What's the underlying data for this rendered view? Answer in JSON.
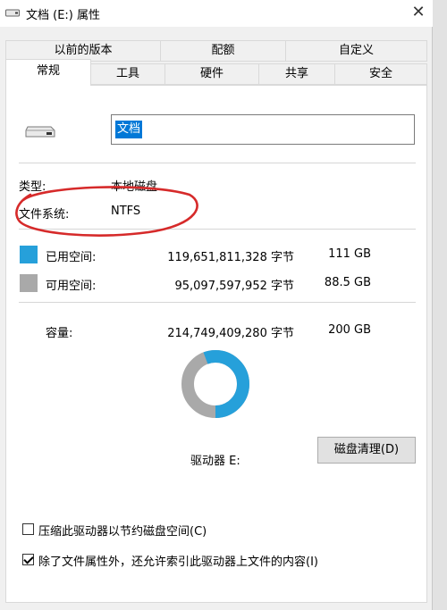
{
  "window": {
    "title": "文档 (E:) 属性",
    "close_glyph": "✕"
  },
  "tabs_row1": [
    "以前的版本",
    "配额",
    "自定义"
  ],
  "tabs_row2": [
    "常规",
    "工具",
    "硬件",
    "共享",
    "安全"
  ],
  "general": {
    "drive_name": "文档",
    "type_label": "类型:",
    "type_value": "本地磁盘",
    "fs_label": "文件系统:",
    "fs_value": "NTFS",
    "used_label": "已用空间:",
    "used_bytes": "119,651,811,328 字节",
    "used_size": "111 GB",
    "free_label": "可用空间:",
    "free_bytes": "95,097,597,952 字节",
    "free_size": "88.5 GB",
    "capacity_label": "容量:",
    "capacity_bytes": "214,749,409,280 字节",
    "capacity_size": "200 GB",
    "drive_label": "驱动器 E:",
    "cleanup_label": "磁盘清理(D)",
    "compress_label": "压缩此驱动器以节约磁盘空间(C)",
    "index_label": "除了文件属性外，还允许索引此驱动器上文件的内容(I)"
  },
  "usage": {
    "used_fraction": 0.557
  },
  "colors": {
    "used": "#26a0da",
    "free": "#a9a9a9",
    "accent": "#0078d7",
    "annotation": "#d62a2a"
  },
  "checkboxes": {
    "compress": false,
    "index": true
  }
}
